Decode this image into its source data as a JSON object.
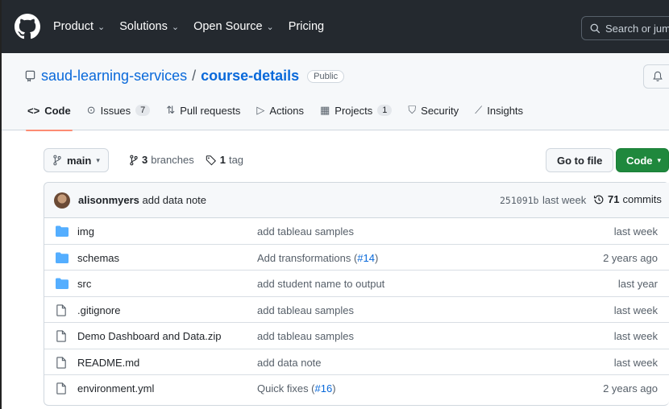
{
  "nav": {
    "items": [
      {
        "label": "Product",
        "has_menu": true
      },
      {
        "label": "Solutions",
        "has_menu": true
      },
      {
        "label": "Open Source",
        "has_menu": true
      },
      {
        "label": "Pricing",
        "has_menu": false
      }
    ],
    "search_placeholder": "Search or jump"
  },
  "repo": {
    "owner": "saud-learning-services",
    "separator": "/",
    "name": "course-details",
    "visibility": "Public"
  },
  "tabs": [
    {
      "label": "Code",
      "icon": "code-icon",
      "glyph": "<>",
      "active": true,
      "count": null
    },
    {
      "label": "Issues",
      "icon": "issue-icon",
      "glyph": "⊙",
      "active": false,
      "count": "7"
    },
    {
      "label": "Pull requests",
      "icon": "pull-request-icon",
      "glyph": "⇅",
      "active": false,
      "count": null
    },
    {
      "label": "Actions",
      "icon": "play-icon",
      "glyph": "▷",
      "active": false,
      "count": null
    },
    {
      "label": "Projects",
      "icon": "table-icon",
      "glyph": "▦",
      "active": false,
      "count": "1"
    },
    {
      "label": "Security",
      "icon": "shield-icon",
      "glyph": "⛉",
      "active": false,
      "count": null
    },
    {
      "label": "Insights",
      "icon": "graph-icon",
      "glyph": "⟋",
      "active": false,
      "count": null
    }
  ],
  "branch": {
    "current": "main",
    "branches_count": "3",
    "branches_label": "branches",
    "tags_count": "1",
    "tags_label": "tag",
    "goto_label": "Go to file",
    "code_label": "Code"
  },
  "commit": {
    "author": "alisonmyers",
    "message": "add data note",
    "sha": "251091b",
    "when": "last week",
    "count": "71",
    "count_label": "commits"
  },
  "files": [
    {
      "type": "dir",
      "name": "img",
      "msg": "add tableau samples",
      "pr": "",
      "msg_end": "",
      "age": "last week"
    },
    {
      "type": "dir",
      "name": "schemas",
      "msg": "Add transformations (",
      "pr": "#14",
      "msg_end": ")",
      "age": "2 years ago"
    },
    {
      "type": "dir",
      "name": "src",
      "msg": "add student name to output",
      "pr": "",
      "msg_end": "",
      "age": "last year"
    },
    {
      "type": "file",
      "name": ".gitignore",
      "msg": "add tableau samples",
      "pr": "",
      "msg_end": "",
      "age": "last week"
    },
    {
      "type": "file",
      "name": "Demo Dashboard and Data.zip",
      "msg": "add tableau samples",
      "pr": "",
      "msg_end": "",
      "age": "last week"
    },
    {
      "type": "file",
      "name": "README.md",
      "msg": "add data note",
      "pr": "",
      "msg_end": "",
      "age": "last week"
    },
    {
      "type": "file",
      "name": "environment.yml",
      "msg": "Quick fixes (",
      "pr": "#16",
      "msg_end": ")",
      "age": "2 years ago"
    }
  ],
  "colors": {
    "header_bg": "#24292f",
    "link": "#0969da",
    "folder": "#54aeff",
    "green": "#1f883d",
    "tab_underline": "#fd8c73"
  }
}
